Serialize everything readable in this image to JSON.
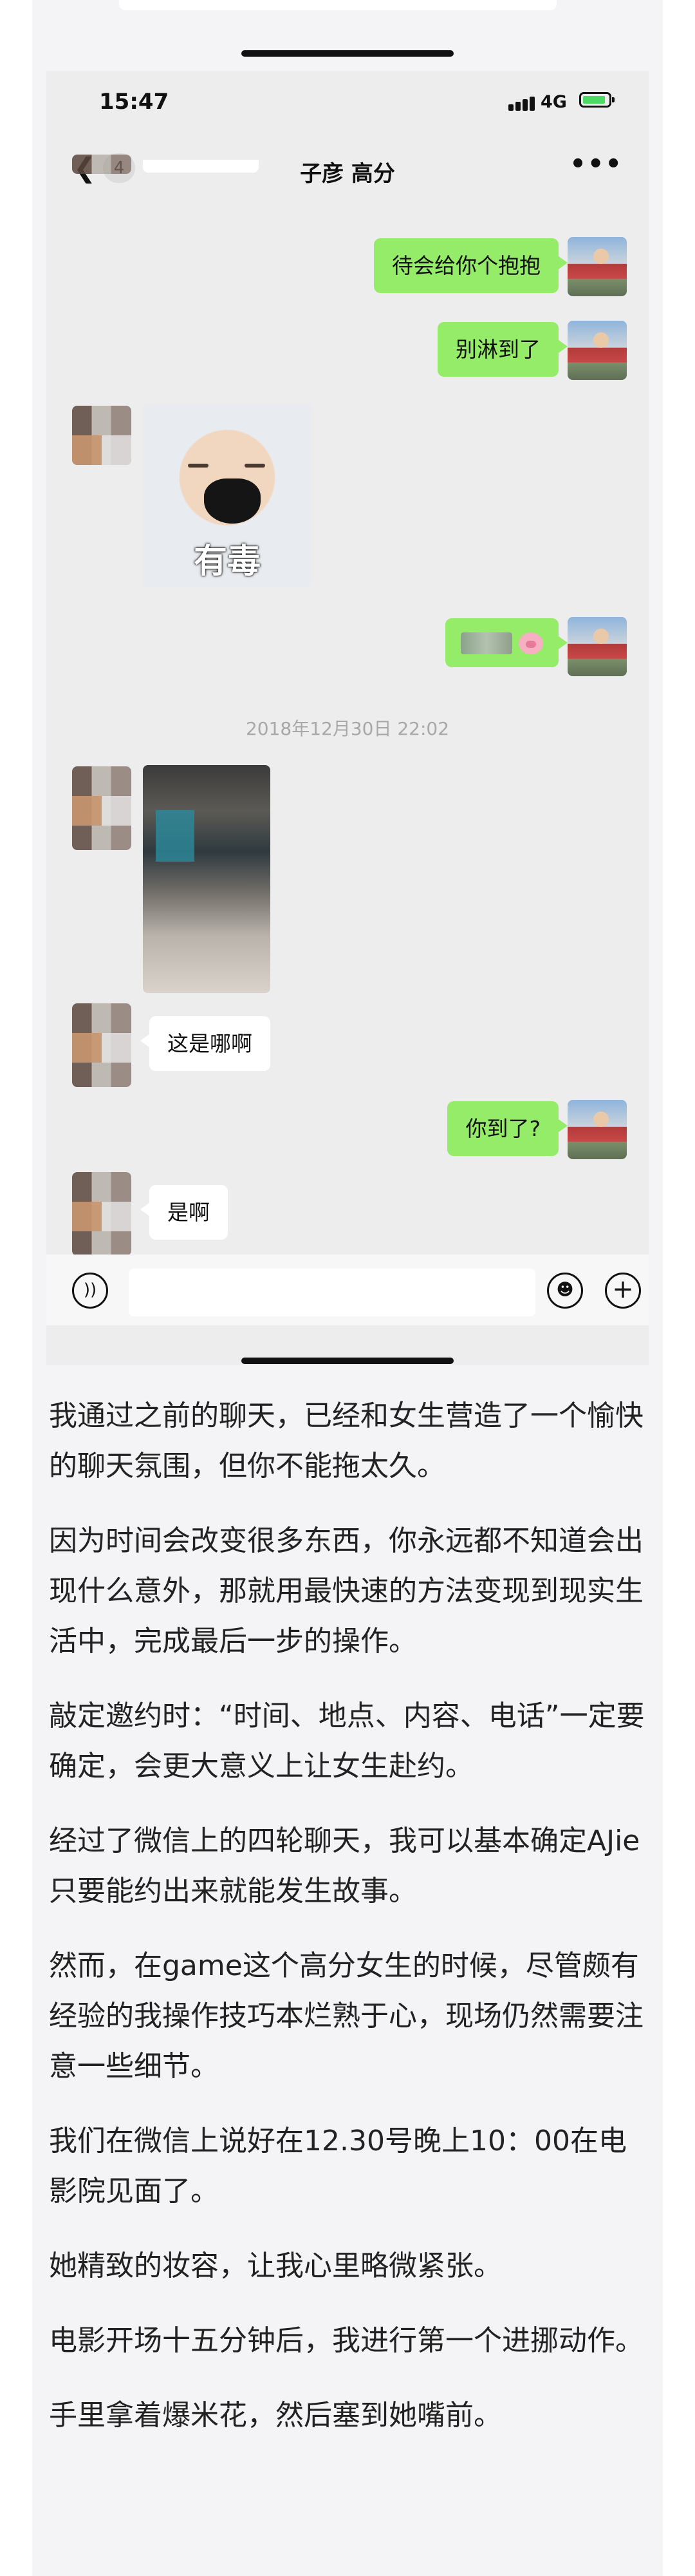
{
  "status_bar": {
    "time": "15:47",
    "network": "4G"
  },
  "chat": {
    "title": "子彦 高分",
    "unread_count": "4",
    "back_icon": "chevron-left-icon",
    "more_icon": "more-dots-icon",
    "messages": [
      {
        "from": "me",
        "text": "待会给你个抱抱"
      },
      {
        "from": "me",
        "text": "别淋到了"
      },
      {
        "from": "other",
        "type": "sticker",
        "caption": "有毒"
      },
      {
        "from": "me",
        "type": "blurred",
        "emoji": "pig-icon"
      },
      {
        "type": "timestamp",
        "text": "2018年12月30日 22:02"
      },
      {
        "from": "other",
        "type": "photo"
      },
      {
        "from": "other",
        "text": "这是哪啊"
      },
      {
        "from": "me",
        "text": "你到了?"
      },
      {
        "from": "other",
        "text": "是啊"
      }
    ],
    "input_bar": {
      "voice_icon": "voice-icon",
      "emoji_icon": "emoji-icon",
      "plus_icon": "plus-icon"
    }
  },
  "article": {
    "paragraphs": [
      "我通过之前的聊天，已经和女生营造了一个愉快的聊天氛围，但你不能拖太久。",
      "因为时间会改变很多东西，你永远都不知道会出现什么意外，那就用最快速的方法变现到现实生活中，完成最后一步的操作。",
      "敲定邀约时：“时间、地点、内容、电话”一定要确定，会更大意义上让女生赴约。",
      "经过了微信上的四轮聊天，我可以基本确定AJie只要能约出来就能发生故事。",
      "然而，在game这个高分女生的时候，尽管颇有经验的我操作技巧本烂熟于心，现场仍然需要注意一些细节。",
      "我们在微信上说好在12.30号晚上10：00在电影院见面了。",
      "她精致的妆容，让我心里略微紧张。",
      "电影开场十五分钟后，我进行第一个进挪动作。",
      "手里拿着爆米花，然后塞到她嘴前。"
    ]
  }
}
